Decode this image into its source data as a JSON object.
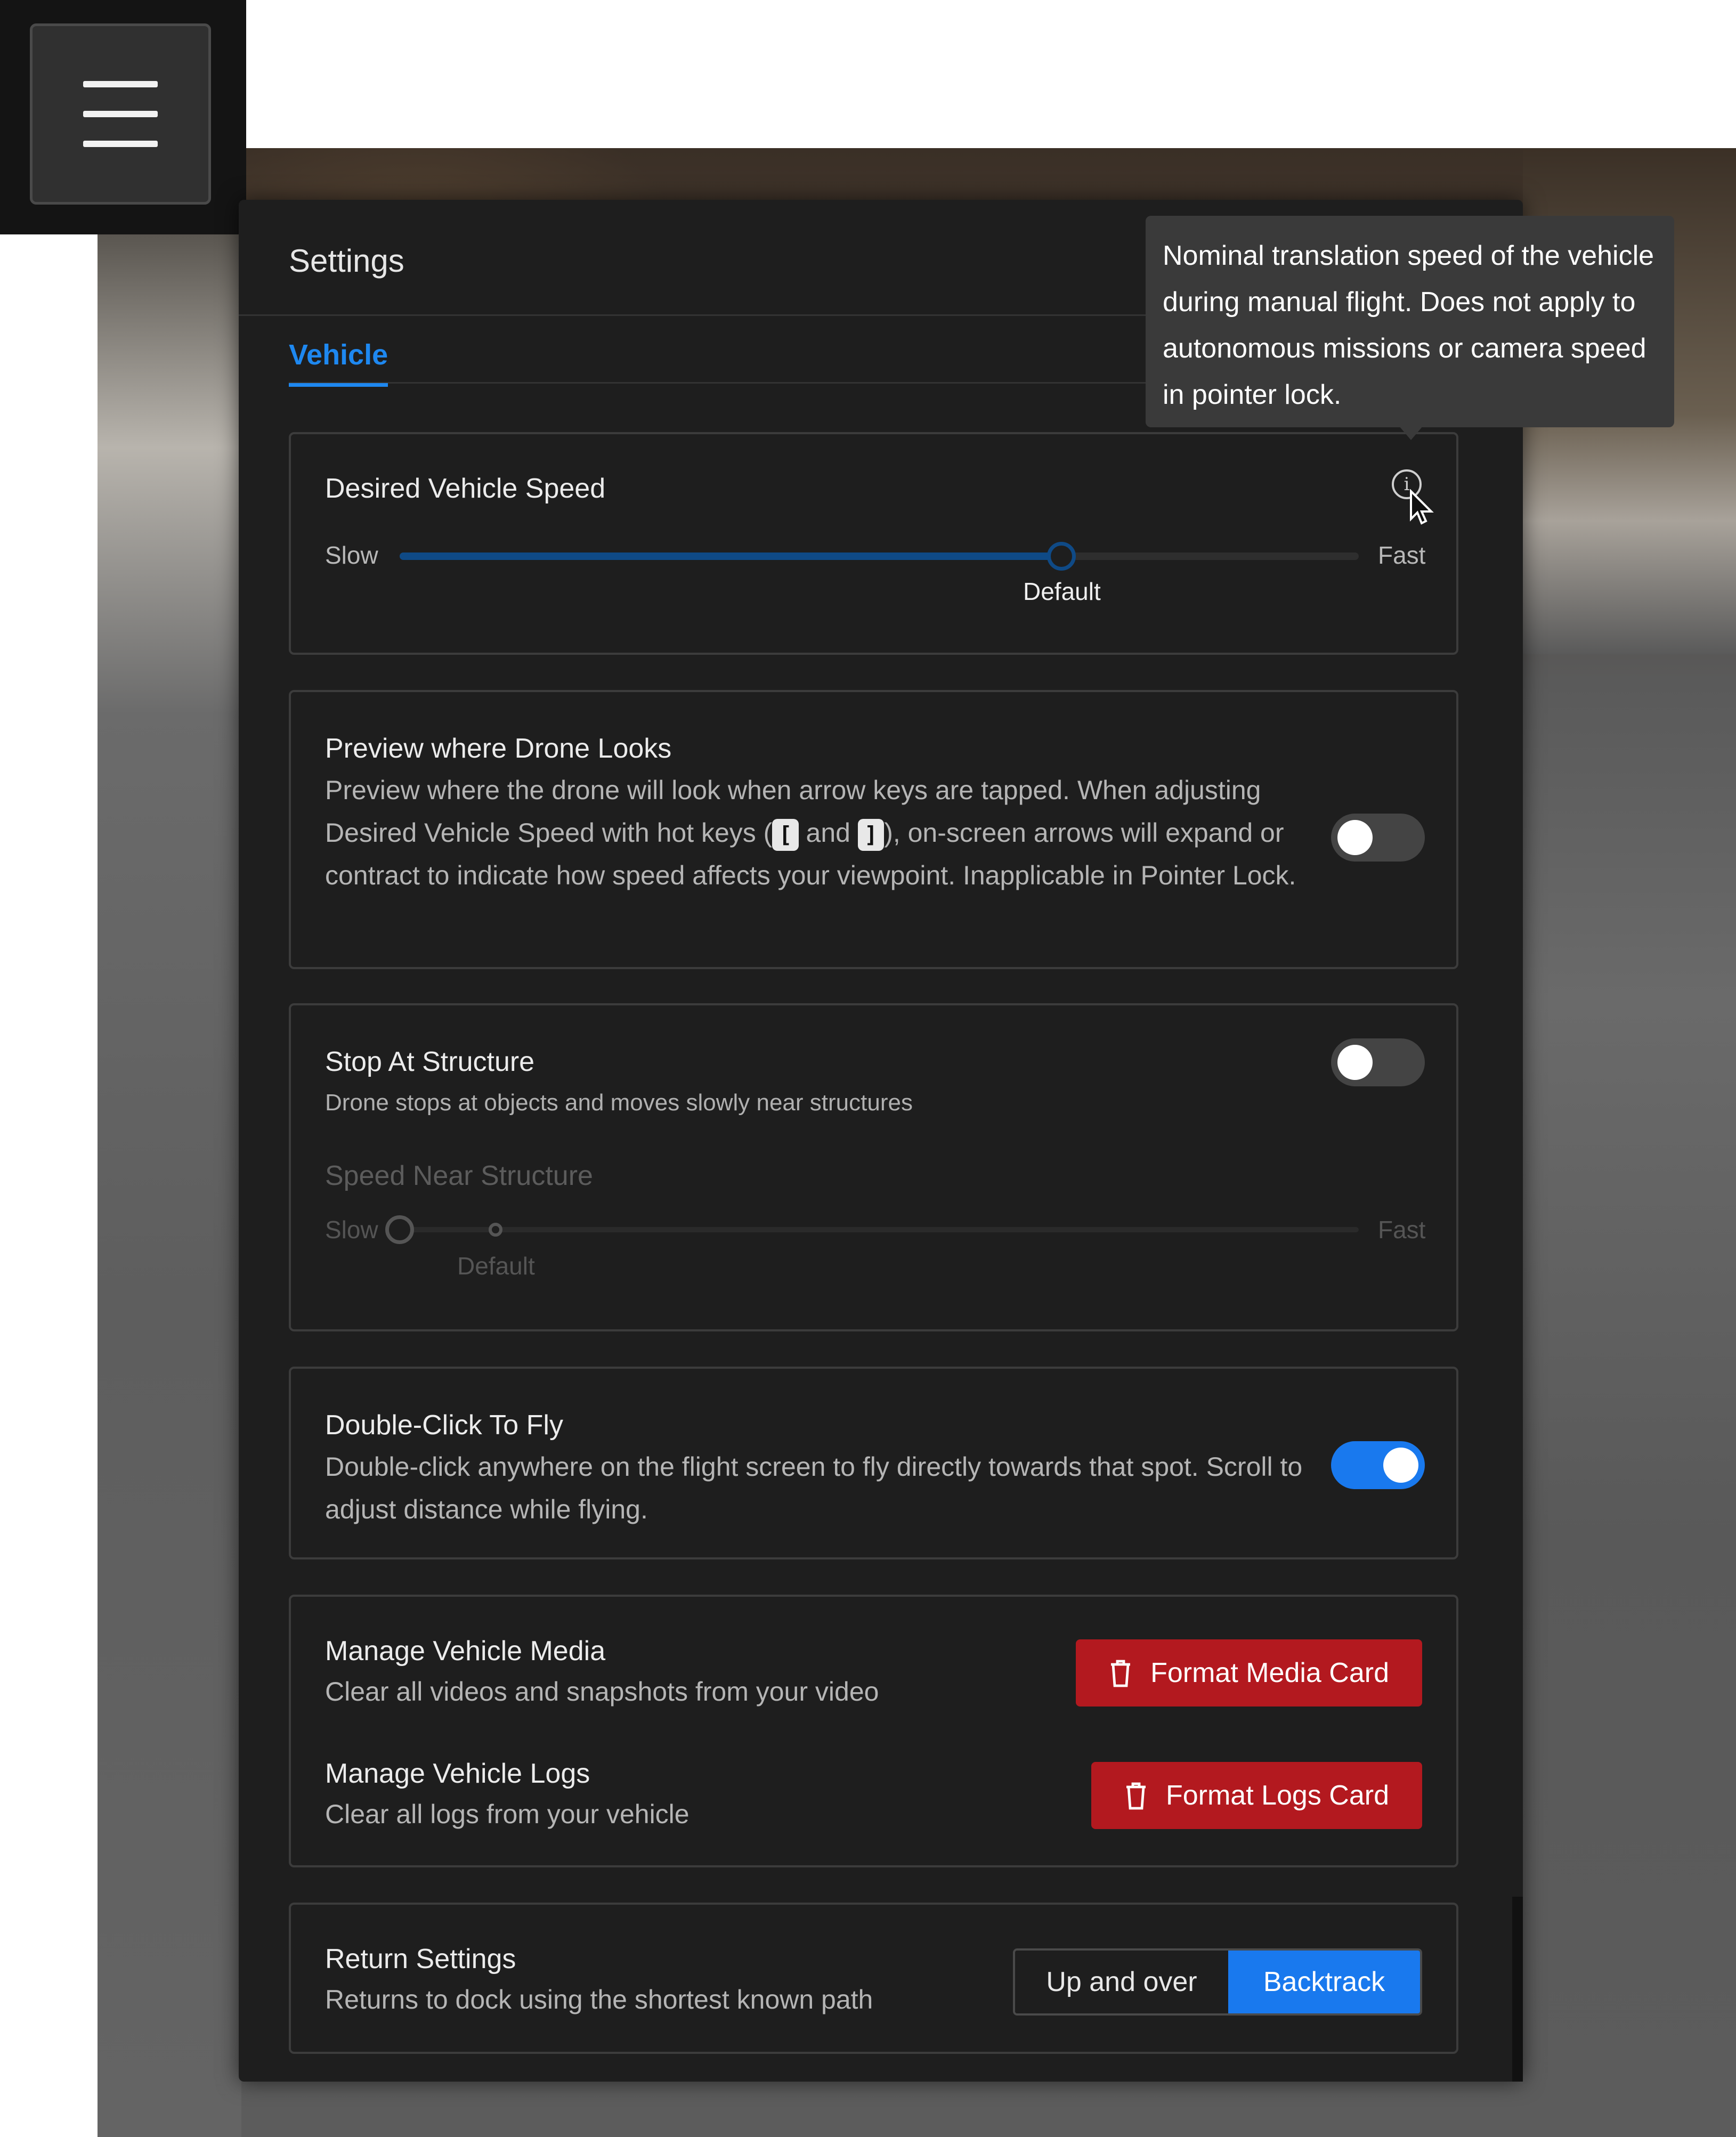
{
  "menu": {
    "icon": "hamburger-icon"
  },
  "panel": {
    "title": "Settings",
    "tab_active": "Vehicle"
  },
  "tooltip": {
    "text": "Nominal translation speed of the vehicle during manual flight. Does not apply to autonomous missions or camera speed in pointer lock."
  },
  "speed": {
    "title": "Desired Vehicle Speed",
    "slow_label": "Slow",
    "fast_label": "Fast",
    "default_label": "Default",
    "value_fraction": 0.69,
    "info_icon": "info-icon"
  },
  "preview": {
    "title": "Preview where Drone Looks",
    "desc_part1": "Preview where the drone will look when arrow keys are tapped. When adjusting Desired Vehicle Speed with hot keys (",
    "key1": "[",
    "desc_and": "and",
    "key2": "]",
    "desc_part2": "), on-screen arrows will expand or contract to indicate how speed affects your viewpoint. Inapplicable in Pointer Lock.",
    "enabled": false
  },
  "stop_structure": {
    "title": "Stop At Structure",
    "desc": "Drone stops at objects and moves slowly near structures",
    "enabled": false,
    "sub_title": "Speed Near Structure",
    "slow_label": "Slow",
    "fast_label": "Fast",
    "default_label": "Default",
    "value_fraction": 0.0,
    "default_fraction": 0.1
  },
  "double_click": {
    "title": "Double-Click To Fly",
    "desc": "Double-click anywhere on the flight screen to fly directly towards that spot. Scroll to adjust distance while flying.",
    "enabled": true
  },
  "media": {
    "title": "Manage Vehicle Media",
    "desc": "Clear all videos and snapshots from your video",
    "button": "Format Media Card",
    "button_icon": "trash-icon"
  },
  "logs": {
    "title": "Manage Vehicle Logs",
    "desc": "Clear all logs from your vehicle",
    "button": "Format Logs Card",
    "button_icon": "trash-icon"
  },
  "return": {
    "title": "Return Settings",
    "desc": "Returns to dock using the shortest known path",
    "options": [
      "Up and over",
      "Backtrack"
    ],
    "selected": "Backtrack"
  },
  "colors": {
    "accent": "#1979ee",
    "danger": "#b3191f",
    "panel_bg": "#1e1e1e"
  }
}
